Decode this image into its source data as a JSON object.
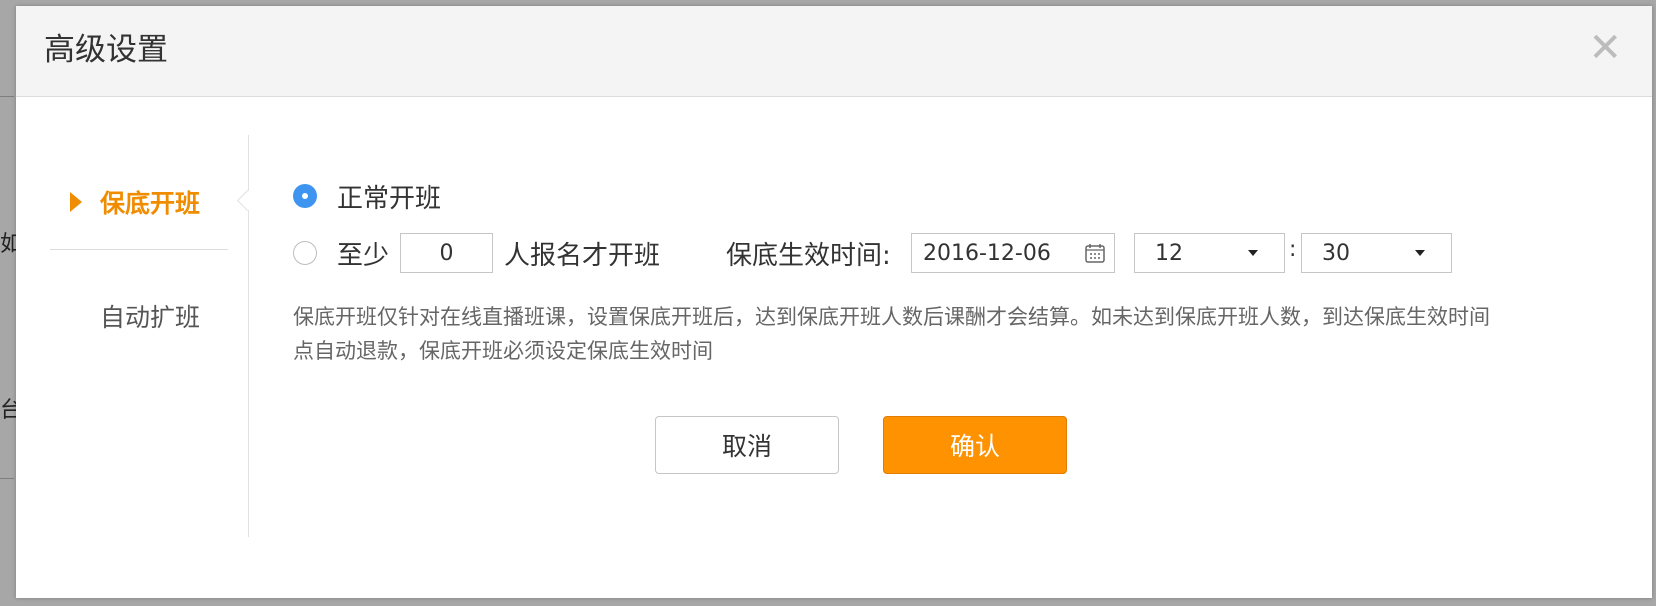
{
  "dialog": {
    "title": "高级设置",
    "close_glyph": "✕"
  },
  "background": {
    "glyph_top": "如",
    "glyph_bottom": "台"
  },
  "sidebar": {
    "items": [
      {
        "label": "保底开班",
        "active": true
      },
      {
        "label": "自动扩班",
        "active": false
      }
    ]
  },
  "options": {
    "normal": {
      "label": "正常开班",
      "checked": true
    },
    "minimum": {
      "prefix": "至少",
      "value": "0",
      "suffix": "人报名才开班",
      "checked": false
    }
  },
  "effective_time": {
    "label": "保底生效时间:",
    "date": "2016-12-06",
    "hour": "12",
    "separator": ":",
    "minute": "30"
  },
  "description": "保底开班仅针对在线直播班课，设置保底开班后，达到保底开班人数后课酬才会结算。如未达到保底开班人数，到达保底生效时间点自动退款，保底开班必须设定保底生效时间",
  "buttons": {
    "cancel": "取消",
    "confirm": "确认"
  },
  "colors": {
    "accent": "#f08c00",
    "confirm_bg": "#ff9200",
    "radio_checked": "#3d95ef"
  },
  "icons": {
    "close": "close-icon",
    "nav_active": "caret-right-icon",
    "date": "calendar-icon",
    "dropdown": "caret-down-icon"
  }
}
